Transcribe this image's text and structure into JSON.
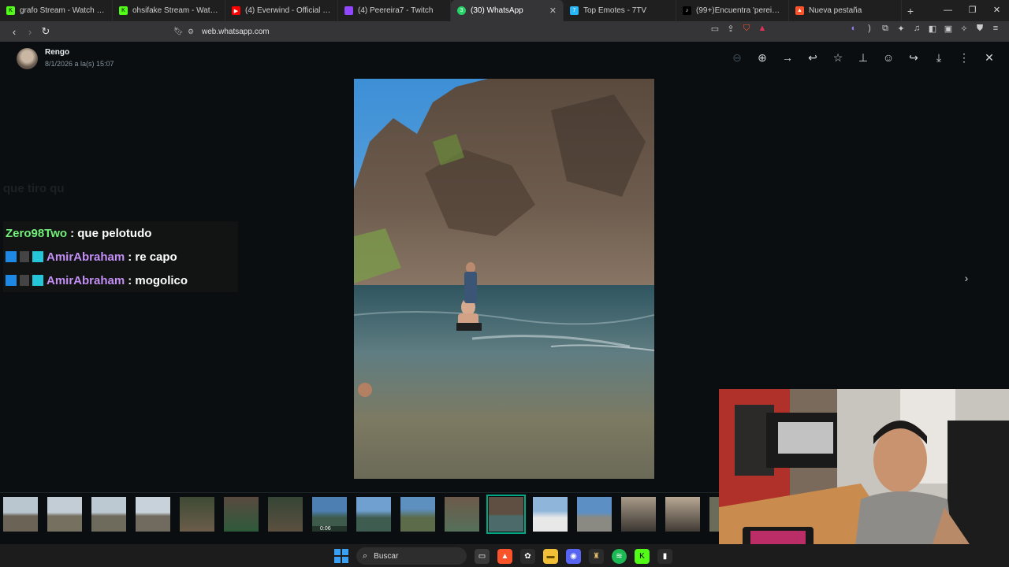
{
  "browser": {
    "tabs": [
      {
        "title": "grafo Stream - Watch Live",
        "color": "#53fc18",
        "active": false
      },
      {
        "title": "ohsifake Stream - Watch Li",
        "color": "#53fc18",
        "active": false
      },
      {
        "title": "(4) Everwind - Official Gameplay",
        "color": "#ff0000",
        "active": false
      },
      {
        "title": "(4) Peereira7 - Twitch",
        "color": "#9146ff",
        "active": false
      },
      {
        "title": "(30) WhatsApp",
        "color": "#25d366",
        "active": true
      },
      {
        "title": "Top Emotes - 7TV",
        "color": "#29b6f6",
        "active": false
      },
      {
        "title": "(99+)Encuentra 'pereira y agu",
        "color": "#000000",
        "active": false
      },
      {
        "title": "Nueva pestaña",
        "color": "#fb542b",
        "active": false
      }
    ],
    "url": "web.whatsapp.com"
  },
  "viewer": {
    "sender_name": "Rengo",
    "sender_date": "8/1/2026 a la(s) 15:07",
    "tools": [
      "zoom-out-icon",
      "zoom-in-icon",
      "forward-icon",
      "reply-icon",
      "star-icon",
      "pin-icon",
      "emoji-icon",
      "share-icon",
      "download-icon",
      "more-icon",
      "close-icon"
    ],
    "thumbnail_count": 17,
    "selected_thumbnail": 11,
    "video_duration": "0:06"
  },
  "chat": {
    "ghost_text": "que tiro qu",
    "messages": [
      {
        "user": "Zero98Two",
        "user_color": "#72f07a",
        "text": ": que pelotudo",
        "badges": false
      },
      {
        "user": "AmirAbraham",
        "user_color": "#c38ff4",
        "text": ": re capo",
        "badges": true
      },
      {
        "user": "AmirAbraham",
        "user_color": "#c38ff4",
        "text": ": mogolico",
        "badges": true
      }
    ]
  },
  "taskbar": {
    "search_placeholder": "Buscar"
  }
}
